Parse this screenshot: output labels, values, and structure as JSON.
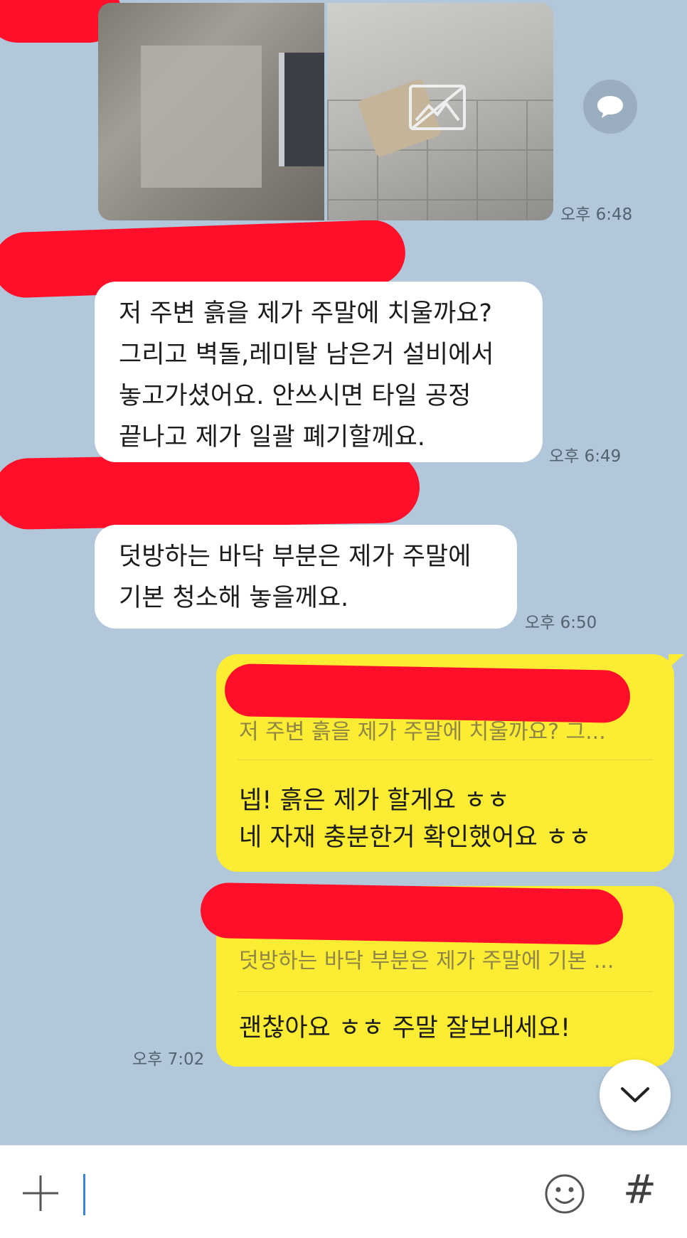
{
  "messages": {
    "photo_time": "오후 6:48",
    "msg1": {
      "lines": [
        "저 주변 흙을 제가 주말에 치울까요?",
        "그리고 벽돌,레미탈 남은거 설비에서",
        "놓고가셨어요. 안쓰시면 타일 공정",
        "끝나고 제가 일괄 폐기할께요."
      ],
      "time": "오후 6:49"
    },
    "msg2": {
      "lines": [
        "덧방하는 바닥 부분은 제가 주말에",
        "기본 청소해 놓을께요."
      ],
      "time": "오후 6:50"
    },
    "reply1": {
      "quote": "저 주변 흙을 제가 주말에 치울까요? 그...",
      "lines": [
        "넵!  흙은 제가 할게요 ㅎㅎ",
        "네 자재 충분한거 확인했어요 ㅎㅎ"
      ]
    },
    "reply2": {
      "quote": "덧방하는 바닥 부분은 제가 주말에 기본 ...",
      "lines": [
        "괜찮아요 ㅎㅎ 주말 잘보내세요!"
      ],
      "time": "오후 7:02"
    }
  },
  "icons": {
    "share": "share-icon",
    "scroll_down": "chevron-down-icon",
    "add": "plus-icon",
    "emoji": "emoji-icon",
    "hashtag": "hashtag-icon",
    "hash_glyph": "#"
  },
  "colors": {
    "background": "#b2c7da",
    "incoming_bubble": "#ffffff",
    "outgoing_bubble": "#fcec33",
    "redaction": "#ff0f2a"
  }
}
